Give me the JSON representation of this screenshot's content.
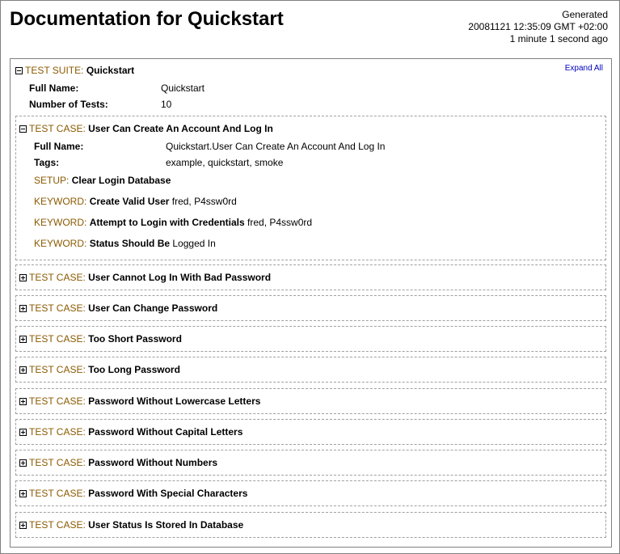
{
  "title": "Documentation for Quickstart",
  "generated": {
    "line1": "Generated",
    "line2": "20081121 12:35:09 GMT +02:00",
    "line3": "1 minute 1 second ago"
  },
  "suite": {
    "kind_label": "TEST SUITE:",
    "name": "Quickstart",
    "expand_all": "Expand All",
    "full_name_label": "Full Name:",
    "full_name": "Quickstart",
    "num_tests_label": "Number of Tests:",
    "num_tests": "10",
    "expanded": true
  },
  "case_kind_label": "TEST CASE:",
  "open_case": {
    "name": "User Can Create An Account And Log In",
    "expanded": true,
    "full_name_label": "Full Name:",
    "full_name": "Quickstart.User Can Create An Account And Log In",
    "tags_label": "Tags:",
    "tags": "example, quickstart, smoke",
    "setup": {
      "kind": "SETUP:",
      "name": "Clear Login Database",
      "args": ""
    },
    "keywords": [
      {
        "kind": "KEYWORD:",
        "name": "Create Valid User",
        "args": "fred, P4ssw0rd"
      },
      {
        "kind": "KEYWORD:",
        "name": "Attempt to Login with Credentials",
        "args": "fred, P4ssw0rd"
      },
      {
        "kind": "KEYWORD:",
        "name": "Status Should Be",
        "args": "Logged In"
      }
    ]
  },
  "collapsed_cases": [
    {
      "name": "User Cannot Log In With Bad Password"
    },
    {
      "name": "User Can Change Password"
    },
    {
      "name": "Too Short Password"
    },
    {
      "name": "Too Long Password"
    },
    {
      "name": "Password Without Lowercase Letters"
    },
    {
      "name": "Password Without Capital Letters"
    },
    {
      "name": "Password Without Numbers"
    },
    {
      "name": "Password With Special Characters"
    },
    {
      "name": "User Status Is Stored In Database"
    }
  ]
}
